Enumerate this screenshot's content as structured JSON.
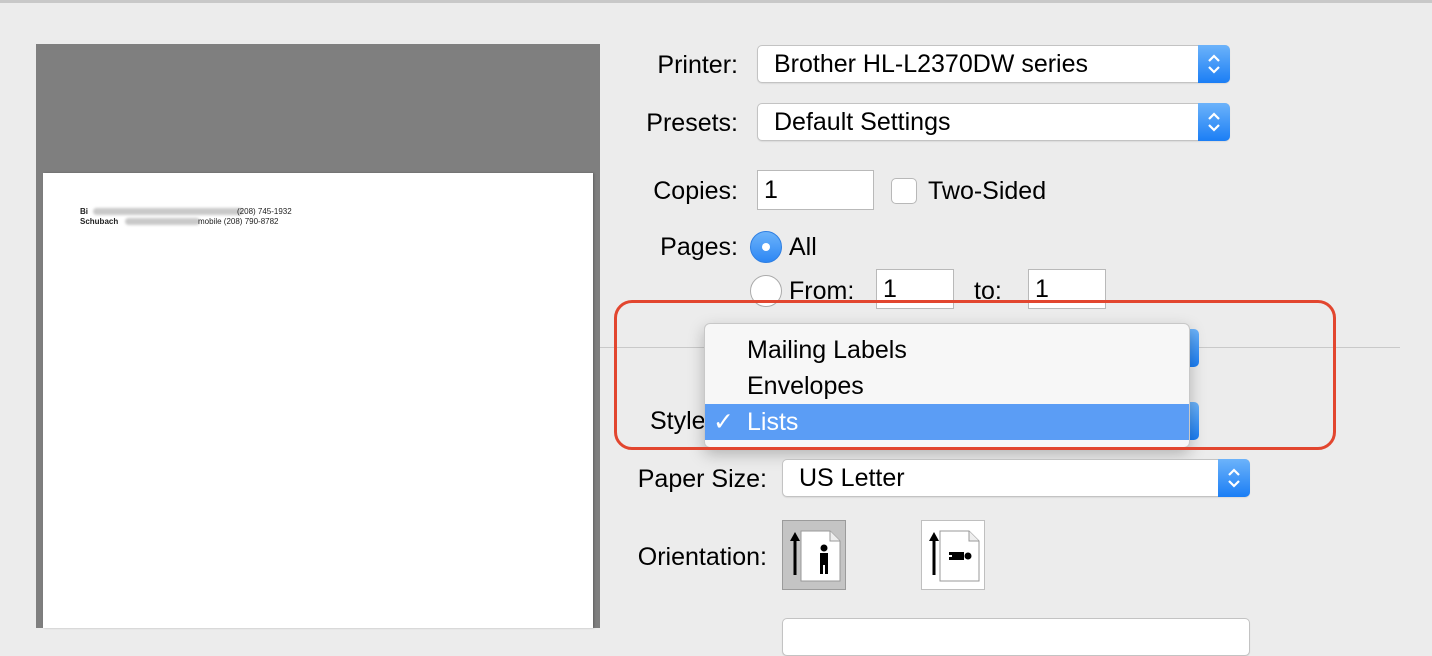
{
  "preview": {
    "line1_name": "Bi",
    "line1_phone": "(208) 745-1932",
    "line2_name": "Schubach",
    "line2_phone": "mobile (208) 790-8782"
  },
  "printer": {
    "label": "Printer:",
    "value": "Brother HL-L2370DW series"
  },
  "presets": {
    "label": "Presets:",
    "value": "Default Settings"
  },
  "copies": {
    "label": "Copies:",
    "value": "1",
    "two_sided_label": "Two-Sided"
  },
  "pages": {
    "label": "Pages:",
    "all_label": "All",
    "from_label": "From:",
    "from_value": "1",
    "to_label": "to:",
    "to_value": "1"
  },
  "style": {
    "label": "Style",
    "menu_items": [
      "Mailing Labels",
      "Envelopes",
      "Lists"
    ],
    "selected_check": "✓"
  },
  "paper_size": {
    "label": "Paper Size:",
    "value": "US Letter"
  },
  "orientation": {
    "label": "Orientation:"
  },
  "colors": {
    "accent": "#2d87f4",
    "menu_selection": "#5b9df5",
    "highlight": "#e2462f"
  }
}
